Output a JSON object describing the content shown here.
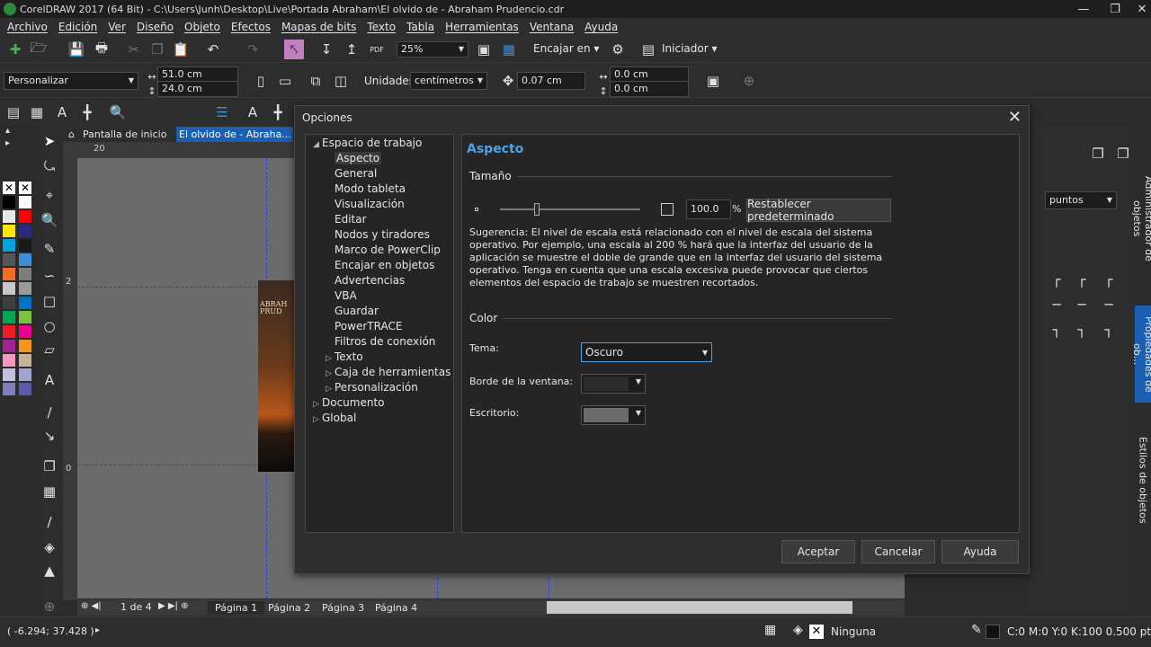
{
  "window": {
    "title": "CorelDRAW 2017 (64 Bit) - C:\\Users\\Junh\\Desktop\\Live\\Portada Abraham\\El olvido de - Abraham Prudencio.cdr"
  },
  "menu": [
    "Archivo",
    "Edición",
    "Ver",
    "Diseño",
    "Objeto",
    "Efectos",
    "Mapas de bits",
    "Texto",
    "Tabla",
    "Herramientas",
    "Ventana",
    "Ayuda"
  ],
  "toolbar": {
    "zoom": "25%",
    "snap_label": "Encajar en",
    "launcher_label": "Iniciador"
  },
  "property_bar": {
    "preset": "Personalizar",
    "width": "51.0 cm",
    "height": "24.0 cm",
    "units_label": "Unidades:",
    "units_value": "centímetros",
    "nudge": "0.07 cm",
    "dup_x": "0.0 cm",
    "dup_y": "0.0 cm"
  },
  "doc_tabs": {
    "home": "Pantalla de inicio",
    "doc": "El olvido de - Abraha..."
  },
  "ruler": {
    "h_mark": "20",
    "v_mark_1": "2",
    "v_mark_2": "0"
  },
  "pages": {
    "counter_current": "1",
    "counter_of": "de",
    "counter_total": "4",
    "tabs": [
      "Página 1",
      "Página 2",
      "Página 3",
      "Página 4"
    ]
  },
  "page_text": {
    "line1": "ABRAH",
    "line2": "PRUD"
  },
  "status": {
    "coords": "( -6.294; 37.428 )",
    "fill": "Ninguna",
    "outline": "C:0 M:0 Y:0 K:100  0.500 pt"
  },
  "right_panel": {
    "units_value": "puntos",
    "tabs": [
      "Administrador de objetos",
      "Propiedades de ob...",
      "Estilos de objetos"
    ]
  },
  "dialog": {
    "title": "Opciones",
    "tree": [
      {
        "label": "Espacio de trabajo",
        "level": 0,
        "arrow": "down"
      },
      {
        "label": "Aspecto",
        "level": 1,
        "selected": true
      },
      {
        "label": "General",
        "level": 1
      },
      {
        "label": "Modo tableta",
        "level": 1
      },
      {
        "label": "Visualización",
        "level": 1
      },
      {
        "label": "Editar",
        "level": 1
      },
      {
        "label": "Nodos y tiradores",
        "level": 1
      },
      {
        "label": "Marco de PowerClip",
        "level": 1
      },
      {
        "label": "Encajar en objetos",
        "level": 1
      },
      {
        "label": "Advertencias",
        "level": 1
      },
      {
        "label": "VBA",
        "level": 1
      },
      {
        "label": "Guardar",
        "level": 1
      },
      {
        "label": "PowerTRACE",
        "level": 1
      },
      {
        "label": "Filtros de conexión",
        "level": 1
      },
      {
        "label": "Texto",
        "level": 1,
        "arrow": "right"
      },
      {
        "label": "Caja de herramientas",
        "level": 1,
        "arrow": "right"
      },
      {
        "label": "Personalización",
        "level": 1,
        "arrow": "right"
      },
      {
        "label": "Documento",
        "level": 0,
        "arrow": "right"
      },
      {
        "label": "Global",
        "level": 0,
        "arrow": "right"
      }
    ],
    "section_title": "Aspecto",
    "size_group": "Tamaño",
    "scale_value": "100.0",
    "scale_unit": "%",
    "scale_level": 0.25,
    "reset_label": "Restablecer predeterminado",
    "hint": "Sugerencia: El nivel de escala está relacionado con el nivel de escala del sistema operativo. Por ejemplo, una escala al 200 % hará que la interfaz del usuario de la aplicación se muestre el doble de grande que en la interfaz del usuario del sistema operativo. Tenga en cuenta que una escala excesiva puede provocar que ciertos elementos del espacio de trabajo se muestren recortados.",
    "color_group": "Color",
    "theme_label": "Tema:",
    "theme_value": "Oscuro",
    "border_label": "Borde de la ventana:",
    "border_color": "#2b2b2b",
    "desktop_label": "Escritorio:",
    "desktop_color": "#6b6b6b",
    "ok": "Aceptar",
    "cancel": "Cancelar",
    "help": "Ayuda"
  },
  "colors": {
    "accent": "#4aa3e8",
    "doc_tab_active": "#1a5fb4",
    "palette": [
      "#000000",
      "#ffffff",
      "#e8e8e8",
      "#ff0000",
      "#ffe600",
      "#2a2a80",
      "#00a3e0",
      "#1a1a1a",
      "#555555",
      "#3f8fd8",
      "#f26d21",
      "#7d7d7d",
      "#c8c8c8",
      "#9a9a9a",
      "#3f3f3f",
      "#0070c0",
      "#00a651",
      "#7cc242",
      "#ed1c24",
      "#ec008c",
      "#a3238e",
      "#f7941d",
      "#f49ac1",
      "#c7b299",
      "#c2c2e0",
      "#a3a3d1",
      "#7f7fc0",
      "#5a5aa8"
    ]
  }
}
